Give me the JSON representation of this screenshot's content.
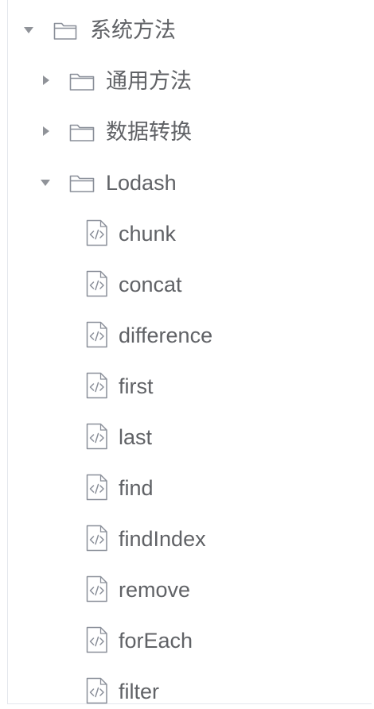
{
  "tree": {
    "root": {
      "label": "系统方法",
      "expanded": true,
      "icon": "folder-open-icon",
      "children": [
        {
          "label": "通用方法",
          "expanded": false,
          "icon": "folder-icon"
        },
        {
          "label": "数据转换",
          "expanded": false,
          "icon": "folder-icon"
        },
        {
          "label": "Lodash",
          "expanded": true,
          "icon": "folder-open-icon",
          "children": [
            {
              "label": "chunk",
              "icon": "code-file-icon"
            },
            {
              "label": "concat",
              "icon": "code-file-icon"
            },
            {
              "label": "difference",
              "icon": "code-file-icon"
            },
            {
              "label": "first",
              "icon": "code-file-icon"
            },
            {
              "label": "last",
              "icon": "code-file-icon"
            },
            {
              "label": "find",
              "icon": "code-file-icon"
            },
            {
              "label": "findIndex",
              "icon": "code-file-icon"
            },
            {
              "label": "remove",
              "icon": "code-file-icon"
            },
            {
              "label": "forEach",
              "icon": "code-file-icon"
            },
            {
              "label": "filter",
              "icon": "code-file-icon"
            }
          ]
        }
      ]
    }
  },
  "colors": {
    "text": "#606266",
    "caret": "#909399",
    "icon_stroke": "#8a8f99",
    "border": "#e4e7ed"
  }
}
